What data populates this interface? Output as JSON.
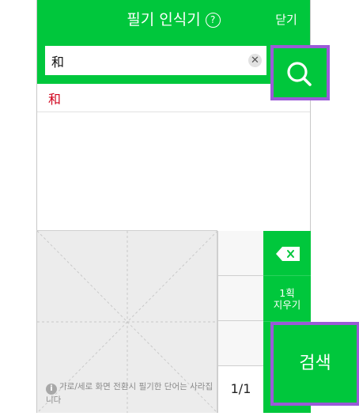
{
  "header": {
    "title": "필기 인식기",
    "help_glyph": "?",
    "close_label": "닫기"
  },
  "search": {
    "value": "和",
    "clear_glyph": "✕"
  },
  "results": [
    {
      "char": "和"
    }
  ],
  "notice": {
    "text": "가로/세로 화면 전환시 필기한 단어는 사라집니다",
    "icon": "info-icon"
  },
  "candidates": {
    "pager": "1/1"
  },
  "actions": {
    "clear_one_line1": "1획",
    "clear_one_line2": "지우기",
    "search_label": "검색"
  },
  "colors": {
    "brand_green": "#00c73c",
    "highlight_purple": "#9b5ad8",
    "result_red": "#d0021b"
  }
}
